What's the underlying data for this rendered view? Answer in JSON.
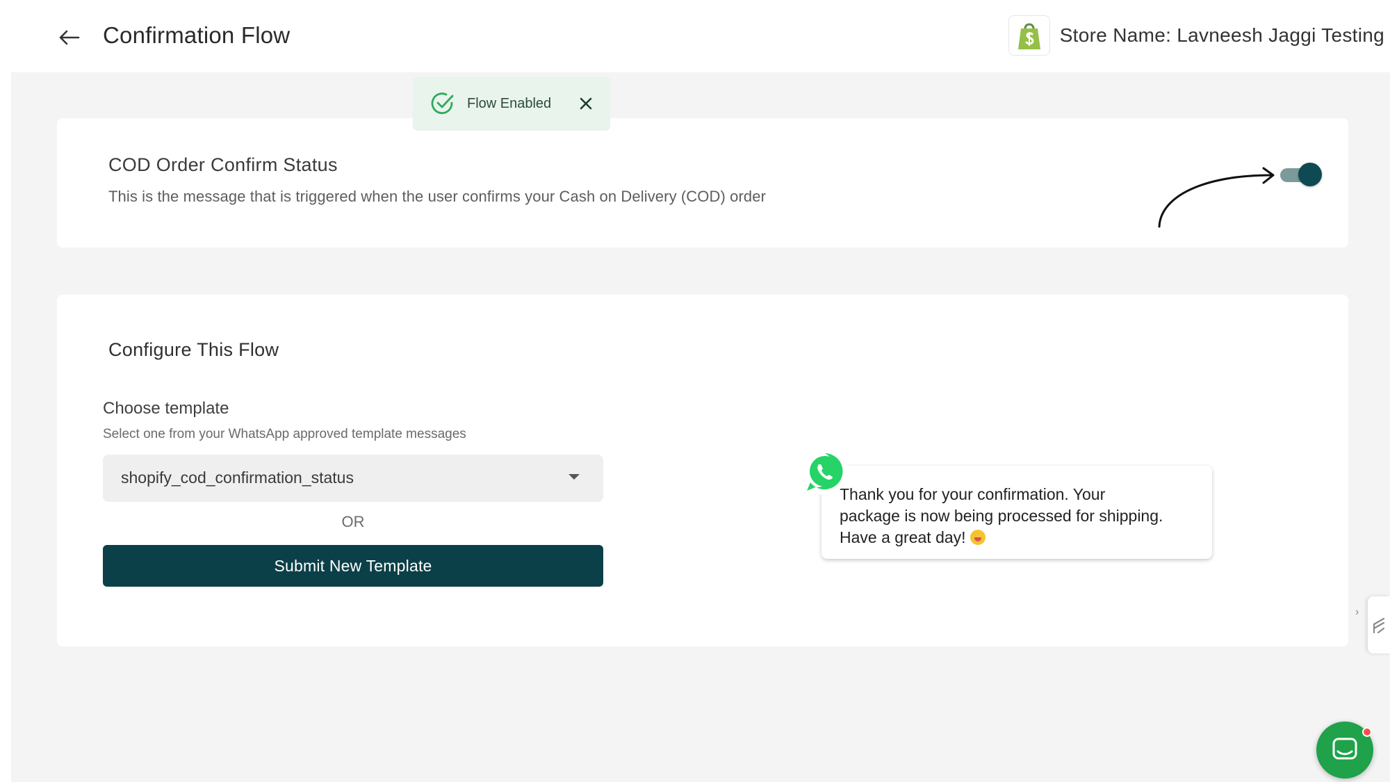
{
  "header": {
    "title": "Confirmation Flow",
    "back_icon": "arrow-left-icon",
    "store_logo_icon": "shopify-bag-icon",
    "store_name": "Store Name: Lavneesh Jaggi Testing"
  },
  "toast": {
    "message": "Flow Enabled",
    "icon": "check-circle-icon",
    "close_icon": "close-icon",
    "color": "#e8f4ec"
  },
  "status_card": {
    "title": "COD Order Confirm Status",
    "description": "This is the message that is triggered when the user confirms your Cash on Delivery (COD) order",
    "toggle_enabled": true,
    "toggle_color": "#0d4a52"
  },
  "config_card": {
    "title": "Configure This Flow",
    "choose_label": "Choose template",
    "choose_help": "Select one from your WhatsApp approved template messages",
    "selected_template": "shopify_cod_confirmation_status",
    "or_text": "OR",
    "submit_label": "Submit New Template",
    "submit_color": "#0c4048"
  },
  "preview": {
    "icon": "whatsapp-icon",
    "line1": "Thank you for your confirmation. Your",
    "line2": "package is now being processed for shipping.",
    "line3": "Have a great day!",
    "emoji_icon": "grinning-face-icon"
  },
  "widgets": {
    "side_tab_icon": "chevron-right-icon",
    "chat_icon": "chat-bubble-icon",
    "chat_color": "#1fa24a"
  }
}
